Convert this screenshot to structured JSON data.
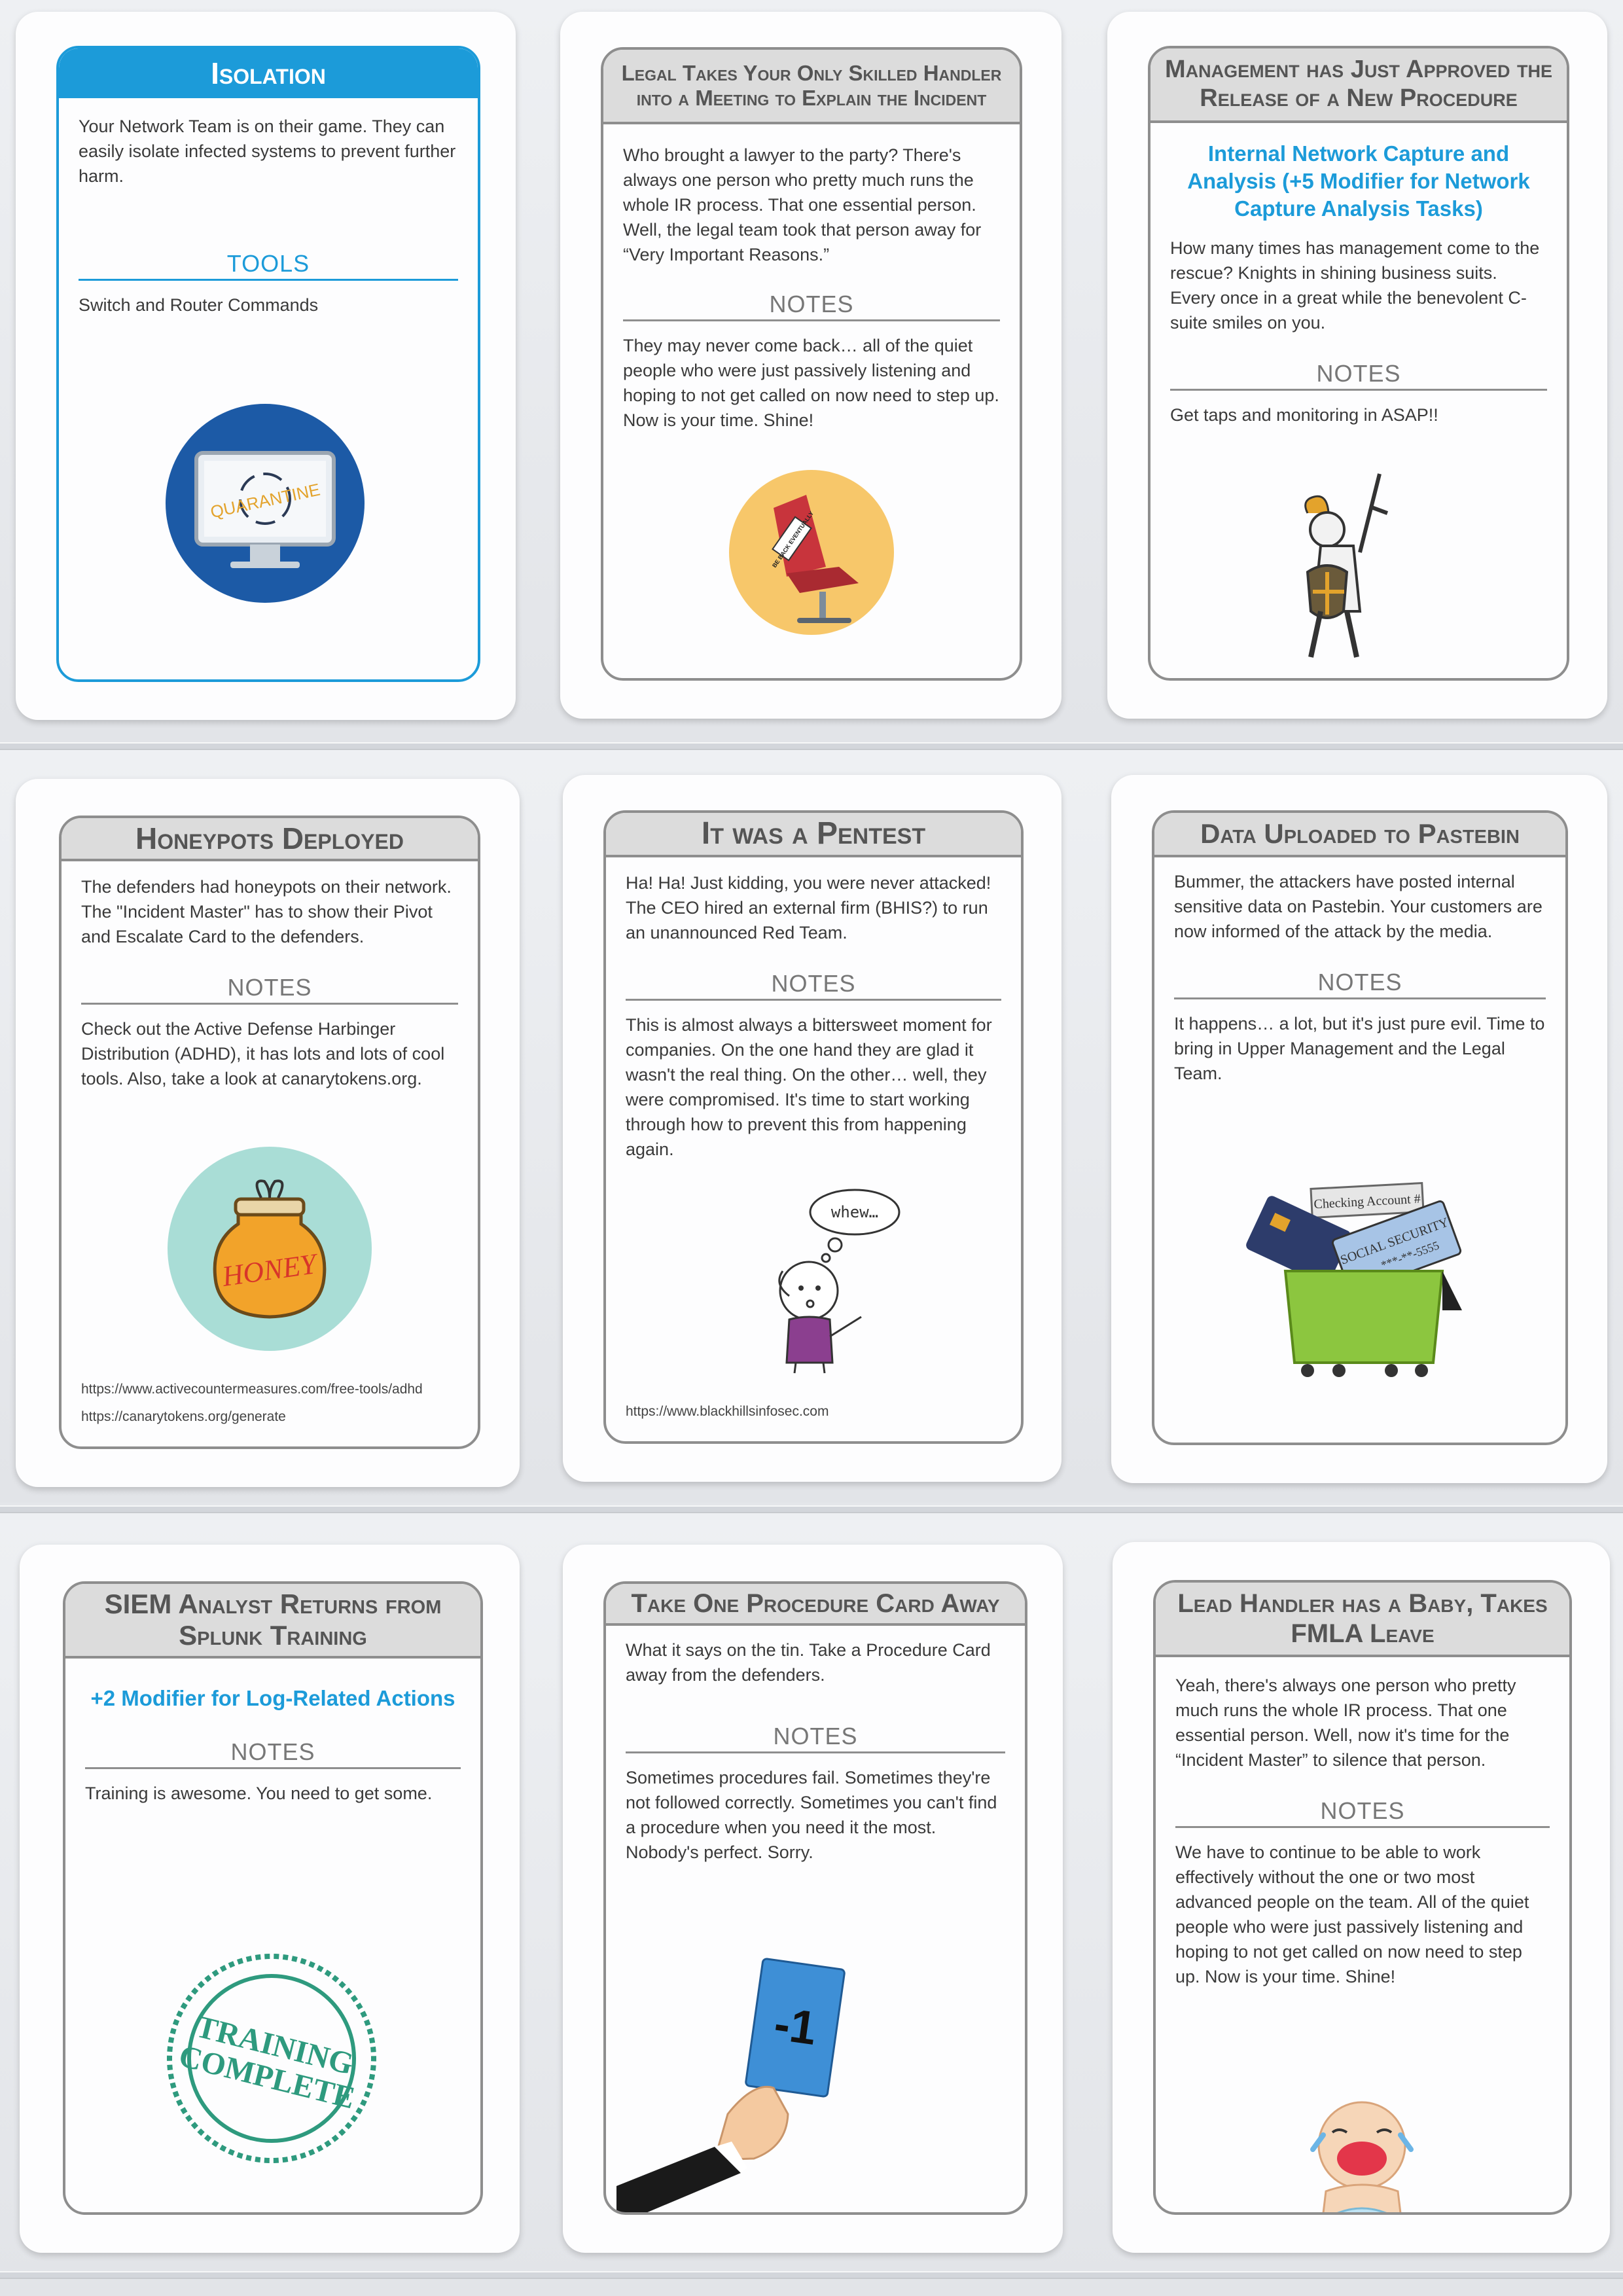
{
  "cards": {
    "isolation": {
      "title": "Isolation",
      "body": "Your Network Team is on their game. They can easily isolate infected systems to prevent further harm.",
      "section": "TOOLS",
      "section_text": "Switch and Router Commands",
      "art_text": "QUARANTINE"
    },
    "legal": {
      "title": "Legal Takes Your Only Skilled Handler into a Meeting to Explain the Incident",
      "body": "Who brought a lawyer to the party? There's always one person who pretty much runs the whole IR process. That one essential person. Well, the legal team took that person away for “Very Important Reasons.”",
      "section": "NOTES",
      "section_text": "They may never come back… all of the quiet people who were just passively listening and hoping to not get called on now need to step up. Now is your time. Shine!",
      "art_text": "BE BACK EVENTUALLY"
    },
    "management": {
      "title": "Management has Just Approved the Release of a New Procedure",
      "modifier": "Internal Network Capture and Analysis (+5 Modifier for Network Capture Analysis Tasks)",
      "body": "How many times has management come to the rescue? Knights in shining business suits. Every once in a great while the benevolent C-suite smiles on you.",
      "section": "NOTES",
      "section_text": "Get taps and monitoring in ASAP!!"
    },
    "honeypots": {
      "title": "Honeypots Deployed",
      "body": "The defenders had honeypots on their network. The \"Incident Master\" has to show their Pivot and Escalate Card to the defenders.",
      "section": "NOTES",
      "section_text": "Check out the Active Defense Harbinger Distribution (ADHD), it has lots and lots of cool tools. Also, take a look at canarytokens.org.",
      "art_text": "HONEY",
      "link1": "https://www.activecountermeasures.com/free-tools/adhd",
      "link2": "https://canarytokens.org/generate"
    },
    "pentest": {
      "title": "It was a Pentest",
      "body": "Ha! Ha! Just kidding, you were never attacked! The CEO hired an external firm (BHIS?) to run an unannounced Red Team.",
      "section": "NOTES",
      "section_text": "This is almost always a bittersweet moment for companies. On the one hand they are glad it wasn't the real thing. On the other… well, they were compromised. It's time to start working through how to prevent this from happening again.",
      "art_text": "whew…",
      "link1": "https://www.blackhillsinfosec.com"
    },
    "pastebin": {
      "title": "Data Uploaded to Pastebin",
      "body": "Bummer, the attackers have posted internal sensitive data on Pastebin. Your customers are now informed of the attack by the media.",
      "section": "NOTES",
      "section_text": "It happens… a lot, but it's just pure evil. Time to bring in Upper Management and the Legal Team.",
      "art_text1": "Checking Account #",
      "art_text2": "SOCIAL SECURITY",
      "art_text3": "***-**-5555"
    },
    "siem": {
      "title": "SIEM Analyst Returns from Splunk Training",
      "modifier": "+2 Modifier for Log-Related Actions",
      "section": "NOTES",
      "section_text": "Training is awesome. You need to get some.",
      "art_text1": "TRAINING",
      "art_text2": "COMPLETE"
    },
    "take_one": {
      "title": "Take One Procedure Card Away",
      "body": "What it says on the tin. Take a Procedure Card away from the defenders.",
      "section": "NOTES",
      "section_text": "Sometimes procedures fail. Sometimes they're not followed correctly. Sometimes you can't find a procedure when you need it the most. Nobody's perfect. Sorry.",
      "art_text": "-1"
    },
    "lead_handler": {
      "title": "Lead Handler has a Baby, Takes FMLA Leave",
      "body": "Yeah, there's always one person who pretty much runs the whole IR process. That one essential person. Well, now it's time for the “Incident Master” to silence that person.",
      "section": "NOTES",
      "section_text": "We have to continue to be able to work effectively without the one or two most advanced people on the team. All of the quiet people who were just passively listening and hoping to not get called on now need to step up. Now is your time. Shine!"
    }
  },
  "colors": {
    "accent": "#1c9bd9",
    "frame": "#8e8e8e",
    "title_bg": "#dcdcdc"
  }
}
